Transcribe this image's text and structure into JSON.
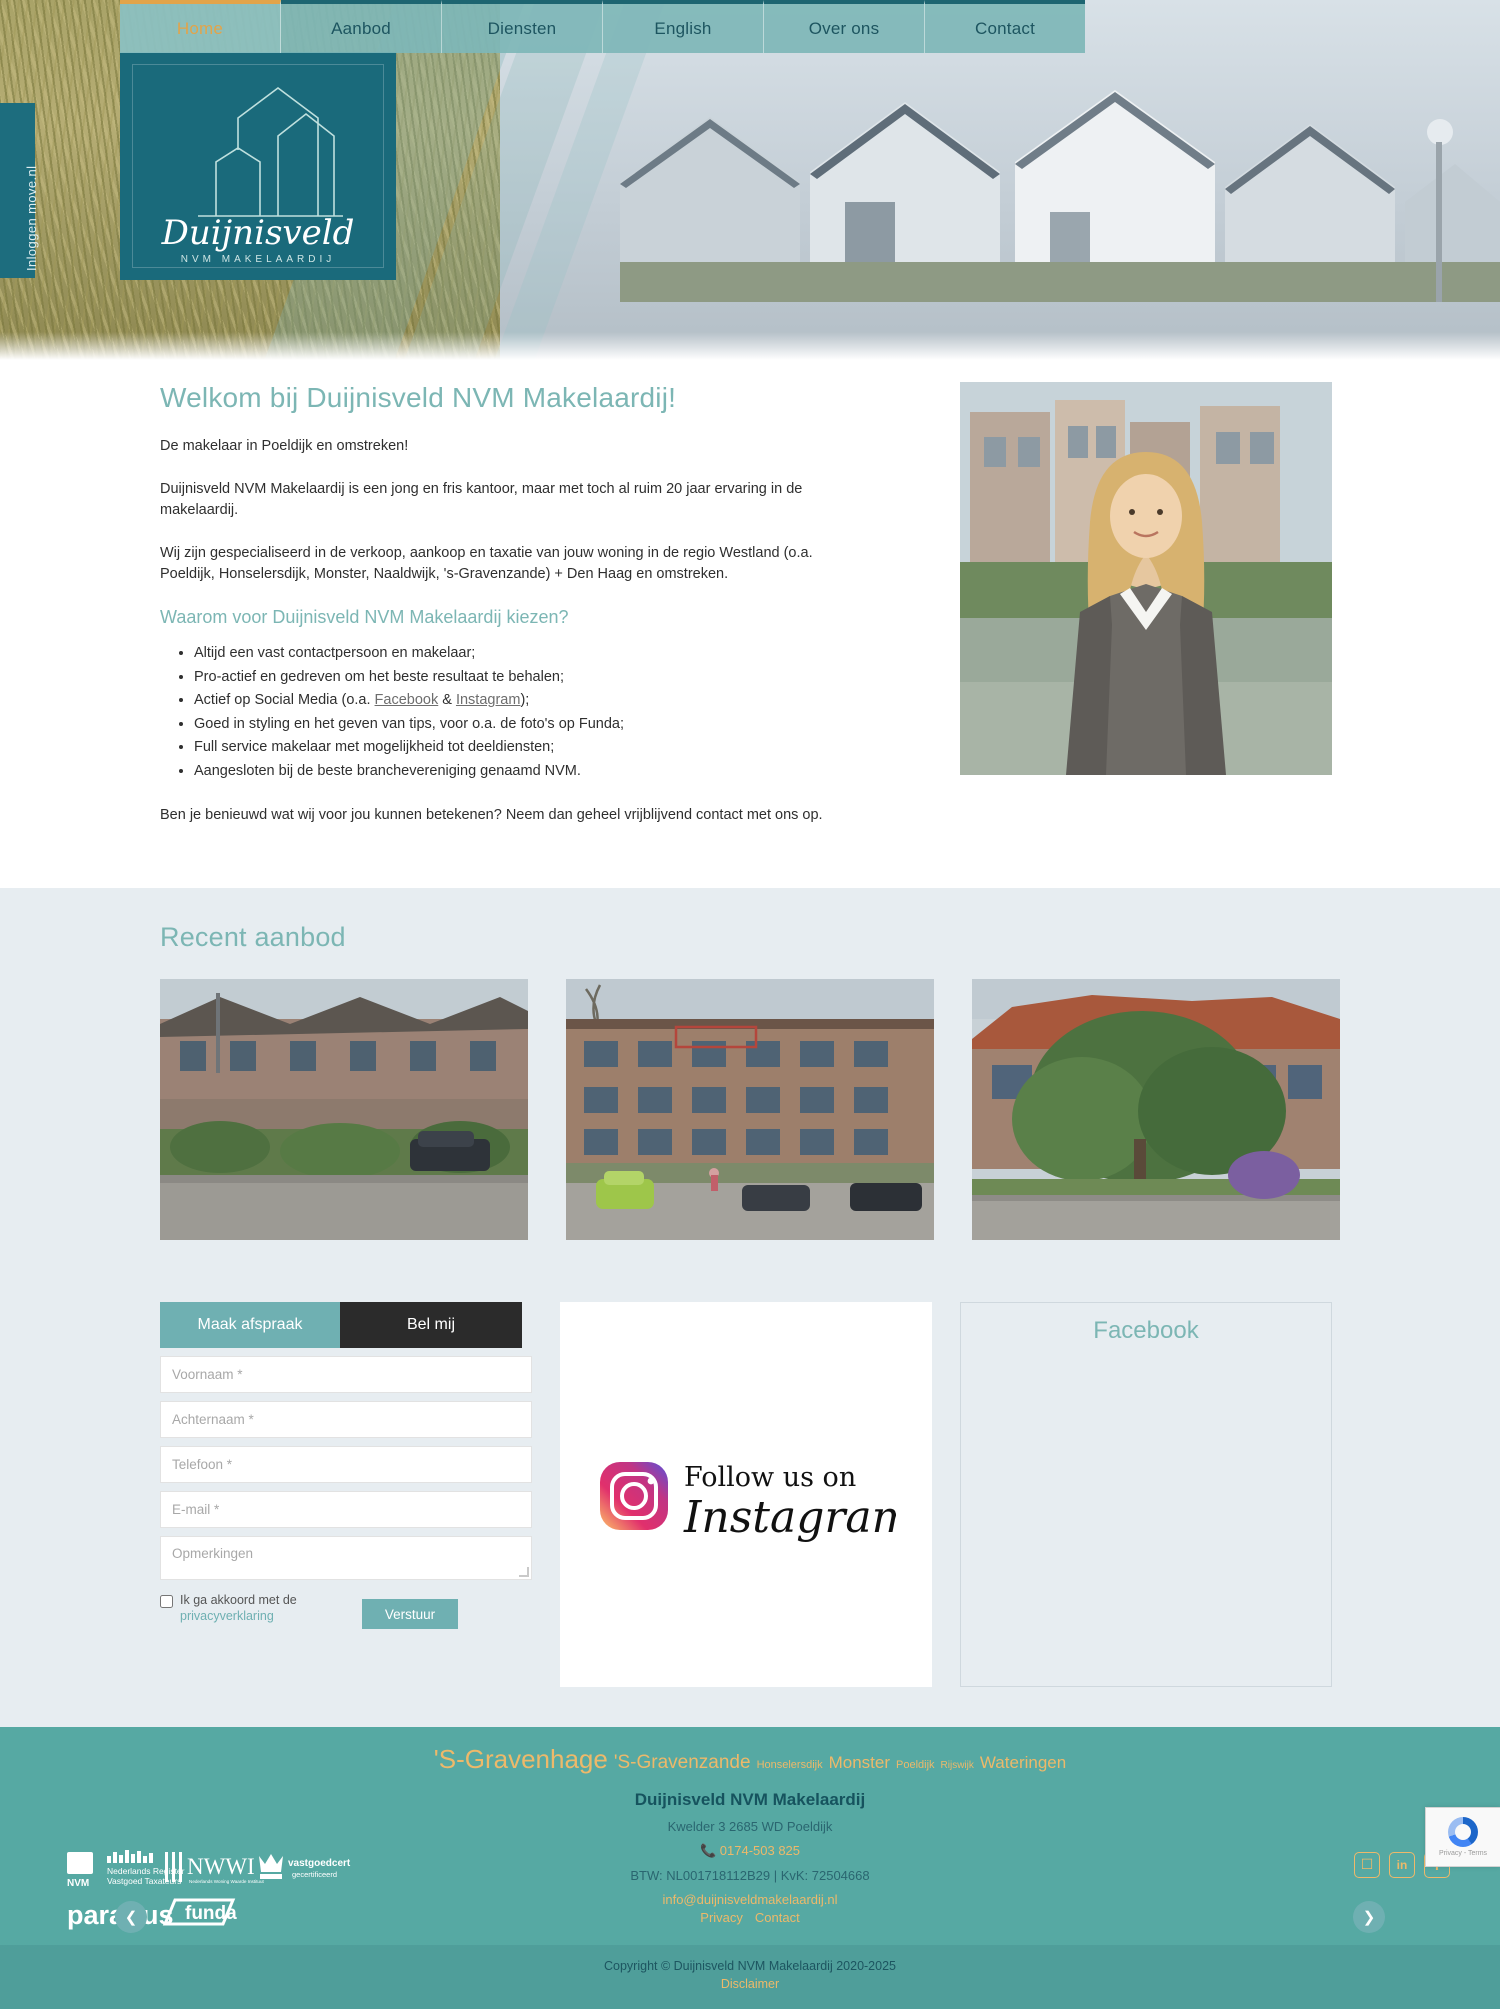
{
  "nav": {
    "items": [
      {
        "label": "Home",
        "active": true
      },
      {
        "label": "Aanbod",
        "active": false
      },
      {
        "label": "Diensten",
        "active": false
      },
      {
        "label": "English",
        "active": false
      },
      {
        "label": "Over ons",
        "active": false
      },
      {
        "label": "Contact",
        "active": false
      }
    ]
  },
  "login_tab": {
    "label": "Inloggen move.nl"
  },
  "logo": {
    "script_name": "Duijnisveld",
    "subtitle": "NVM MAKELAARDIJ"
  },
  "welcome": {
    "heading": "Welkom bij Duijnisveld NVM Makelaardij!",
    "intro": "De makelaar in Poeldijk en omstreken!",
    "paragraph1": "Duijnisveld NVM Makelaardij is een jong en fris kantoor, maar met toch al ruim 20 jaar ervaring in de makelaardij.",
    "paragraph2": "Wij zijn gespecialiseerd in de verkoop, aankoop en taxatie van jouw woning in de regio Westland (o.a. Poeldijk, Honselersdijk, Monster, Naaldwijk, 's-Gravenzande) + Den Haag en omstreken.",
    "subheading": "Waarom voor Duijnisveld NVM Makelaardij kiezen?",
    "bullets": [
      "Altijd een vast contactpersoon en makelaar;",
      "Pro-actief en gedreven om het beste resultaat te behalen;",
      "Goed in styling en het geven van tips, voor o.a. de foto's op Funda;",
      "Full service makelaar met mogelijkheid tot deeldiensten;",
      "Aangesloten bij de beste branchevereniging genaamd NVM."
    ],
    "social_bullet": {
      "prefix": "Actief op Social Media (o.a. ",
      "link1": "Facebook",
      "middle": " & ",
      "link2": "Instagram",
      "suffix": ");"
    },
    "closing": "Ben je benieuwd wat wij voor jou kunnen betekenen? Neem dan geheel vrijblijvend contact met ons op."
  },
  "aanbod": {
    "heading": "Recent aanbod",
    "prev_icon": "chevron-left-icon",
    "next_icon": "chevron-right-icon",
    "cards": [
      {
        "alt": "Rijtjeswoningen met straat en auto's"
      },
      {
        "alt": "Appartementencomplex met geparkeerde auto's"
      },
      {
        "alt": "Woning met grote boom voor de gevel"
      }
    ]
  },
  "recaptcha": {
    "text": "Privacy - Terms"
  },
  "contact_form": {
    "tab_appointment": "Maak afspraak",
    "tab_callme": "Bel mij",
    "fields": [
      {
        "name": "voornaam",
        "placeholder": "Voornaam *",
        "value": ""
      },
      {
        "name": "achternaam",
        "placeholder": "Achternaam *",
        "value": ""
      },
      {
        "name": "telefoon",
        "placeholder": "Telefoon *",
        "value": ""
      },
      {
        "name": "email",
        "placeholder": "E-mail *",
        "value": ""
      }
    ],
    "remarks_placeholder": "Opmerkingen",
    "consent_text": "Ik ga akkoord met de",
    "consent_link": "privacyverklaring",
    "submit_label": "Verstuur"
  },
  "instagram": {
    "line1": "Follow us on",
    "line2": "Instagram"
  },
  "facebook": {
    "heading": "Facebook"
  },
  "footer": {
    "tags": [
      {
        "label": "'S-Gravenhage",
        "size": 26
      },
      {
        "label": "'S-Gravenzande",
        "size": 19
      },
      {
        "label": "Honselersdijk",
        "size": 11
      },
      {
        "label": "Monster",
        "size": 17
      },
      {
        "label": "Poeldijk",
        "size": 11
      },
      {
        "label": "Rijswijk",
        "size": 10
      },
      {
        "label": "Wateringen",
        "size": 17
      }
    ],
    "company": "Duijnisveld NVM Makelaardij",
    "address": "Kwelder 3  2685 WD Poeldijk",
    "phone": "0174-503 825",
    "phone_icon": "phone-icon",
    "btw": "BTW: NL001718112B29 | KvK: 72504668",
    "email": "info@duijnisveldmakelaardij.nl",
    "links": [
      {
        "label": "Privacy"
      },
      {
        "label": "Contact"
      }
    ],
    "certifications": [
      {
        "name": "NVM",
        "sub": ""
      },
      {
        "name": "Nederlands Register",
        "sub": "Vastgoed Taxateurs"
      },
      {
        "name": "NWWI",
        "sub": "Nederlands Woning Waarde Instituut"
      },
      {
        "name": "vastgoedcert",
        "sub": "gecertificeerd"
      },
      {
        "name": "pararius",
        "sub": ""
      },
      {
        "name": "funda",
        "sub": ""
      }
    ],
    "social": [
      {
        "name": "instagram-icon",
        "glyph": "◻"
      },
      {
        "name": "linkedin-icon",
        "glyph": "in"
      },
      {
        "name": "facebook-icon",
        "glyph": "f"
      }
    ]
  },
  "copyright": {
    "text": "Copyright © Duijnisveld NVM Makelaardij 2020-2025",
    "disclaimer": "Disclaimer"
  }
}
